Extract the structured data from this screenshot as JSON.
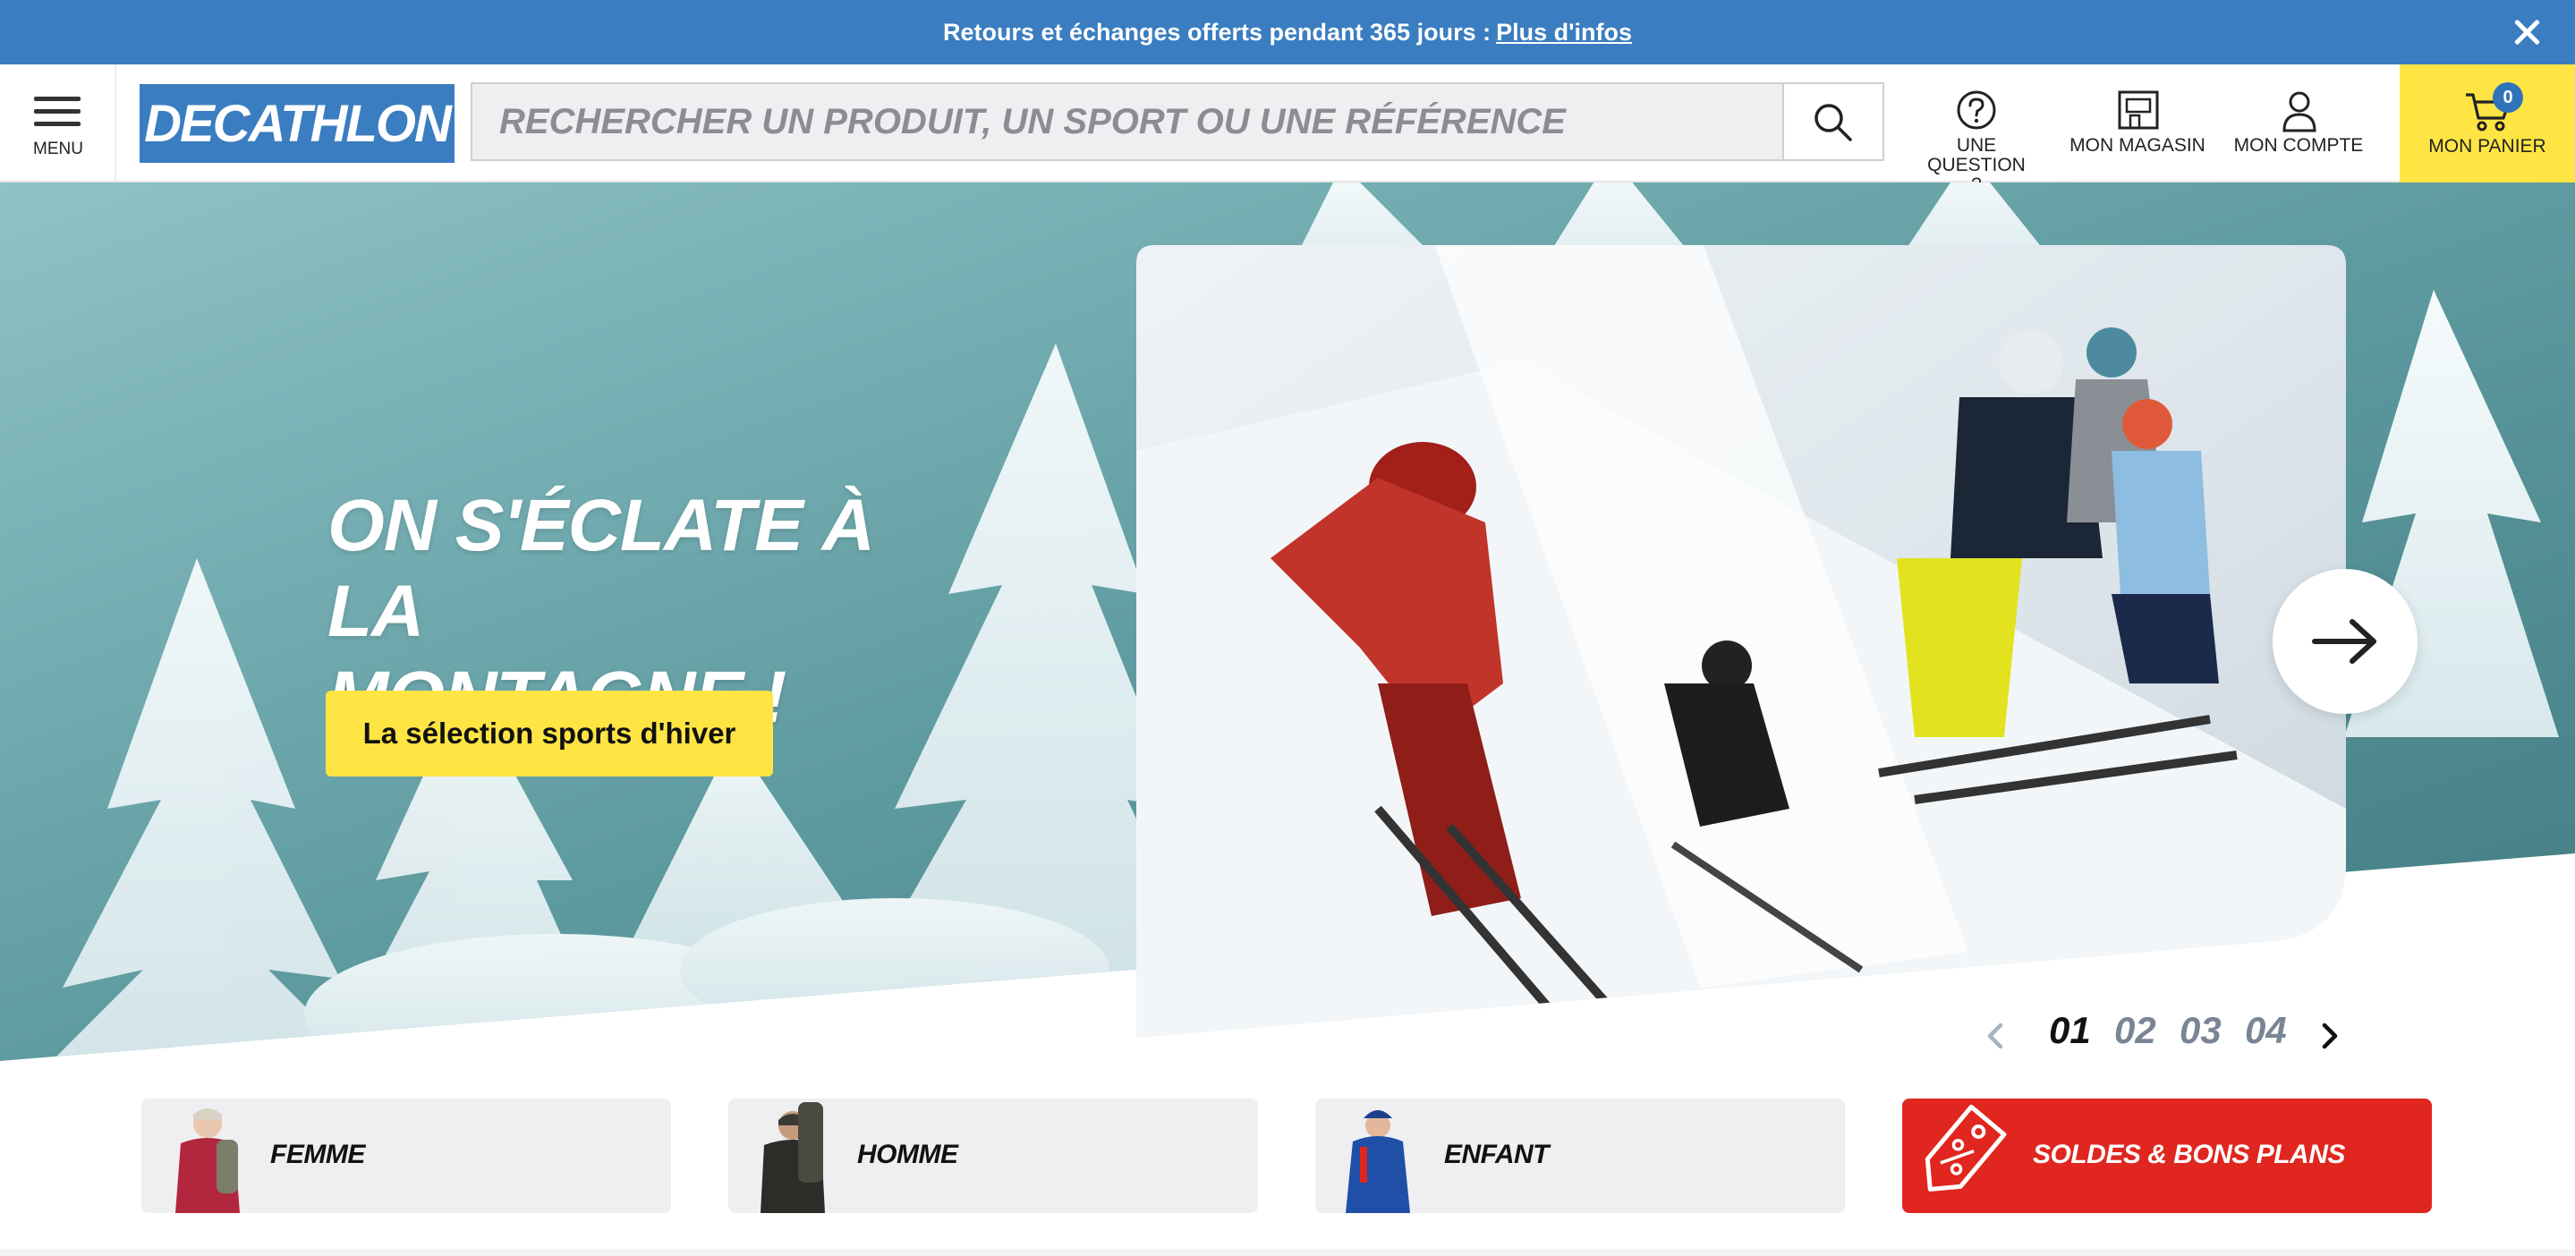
{
  "promo": {
    "text": "Retours et échanges offerts pendant 365 jours :",
    "link": "Plus d'infos"
  },
  "header": {
    "menu_label": "MENU",
    "logo": "DECATHLON",
    "search_placeholder": "RECHERCHER UN PRODUIT, UN SPORT OU UNE RÉFÉRENCE",
    "question_label_1": "UNE QUESTION",
    "question_label_2": "?",
    "store_label": "MON MAGASIN",
    "account_label": "MON COMPTE",
    "cart_label": "MON PANIER",
    "cart_count": "0"
  },
  "hero": {
    "title_line1": "ON S'ÉCLATE À LA",
    "title_line2": "MONTAGNE !",
    "cta": "La sélection sports d'hiver"
  },
  "pager": {
    "pages": [
      "01",
      "02",
      "03",
      "04"
    ],
    "active": "01"
  },
  "categories": [
    {
      "label": "FEMME"
    },
    {
      "label": "HOMME"
    },
    {
      "label": "ENFANT"
    },
    {
      "label": "SOLDES & BONS PLANS"
    }
  ],
  "colors": {
    "brand_blue": "#3a7dc0",
    "cta_yellow": "#fee544",
    "sale_red": "#e0261f"
  },
  "icons": [
    "close-icon",
    "menu-icon",
    "search-icon",
    "question-icon",
    "store-icon",
    "account-icon",
    "cart-icon",
    "arrow-right-icon",
    "chevron-left-icon",
    "chevron-right-icon",
    "price-tag-icon"
  ]
}
